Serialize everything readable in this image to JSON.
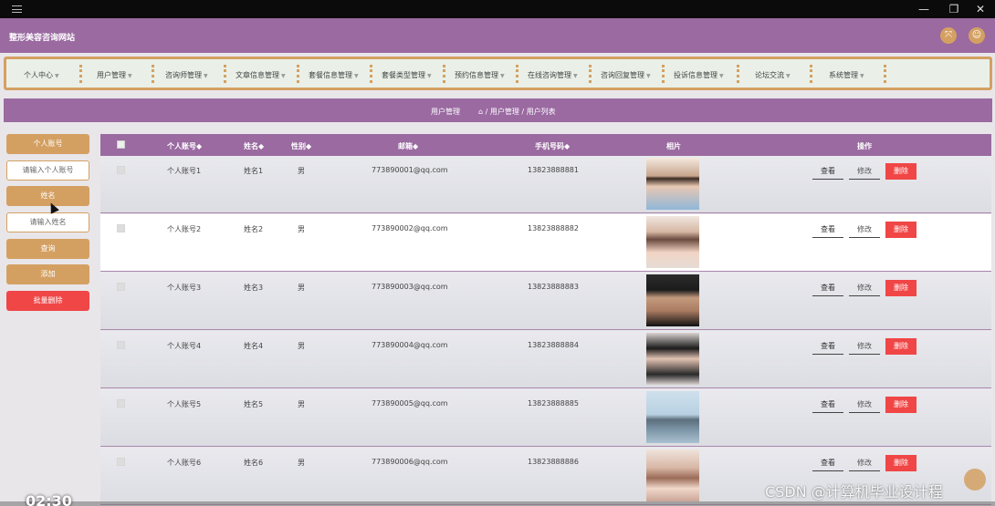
{
  "window": {
    "minimize": "—",
    "restore": "❐",
    "close": "✕"
  },
  "header": {
    "title": "整形美容咨询网站"
  },
  "nav": {
    "items": [
      {
        "label": "个人中心"
      },
      {
        "label": "用户管理"
      },
      {
        "label": "咨询师管理"
      },
      {
        "label": "文章信息管理"
      },
      {
        "label": "套餐信息管理"
      },
      {
        "label": "套餐类型管理"
      },
      {
        "label": "预约信息管理"
      },
      {
        "label": "在线咨询管理"
      },
      {
        "label": "咨询回复管理"
      },
      {
        "label": "投诉信息管理"
      },
      {
        "label": "论坛交流"
      },
      {
        "label": "系统管理"
      }
    ],
    "caret": "▼"
  },
  "breadcrumb": {
    "section": "用户管理",
    "path": "/ 用户管理 / 用户列表",
    "home_icon": "⌂"
  },
  "left": {
    "account_label": "个人账号",
    "account_placeholder": "请输入个人账号",
    "name_label": "姓名",
    "name_placeholder": "请输入姓名",
    "search": "查询",
    "add": "添加",
    "batch_delete": "批量删除"
  },
  "table": {
    "headers": {
      "account": "个人账号◆",
      "name": "姓名◆",
      "gender": "性别◆",
      "email": "邮箱◆",
      "phone": "手机号码◆",
      "photo": "相片",
      "actions": "操作"
    },
    "rows": [
      {
        "account": "个人账号1",
        "name": "姓名1",
        "gender": "男",
        "email": "773890001@qq.com",
        "phone": "13823888881"
      },
      {
        "account": "个人账号2",
        "name": "姓名2",
        "gender": "男",
        "email": "773890002@qq.com",
        "phone": "13823888882"
      },
      {
        "account": "个人账号3",
        "name": "姓名3",
        "gender": "男",
        "email": "773890003@qq.com",
        "phone": "13823888883"
      },
      {
        "account": "个人账号4",
        "name": "姓名4",
        "gender": "男",
        "email": "773890004@qq.com",
        "phone": "13823888884"
      },
      {
        "account": "个人账号5",
        "name": "姓名5",
        "gender": "男",
        "email": "773890005@qq.com",
        "phone": "13823888885"
      },
      {
        "account": "个人账号6",
        "name": "姓名6",
        "gender": "男",
        "email": "773890006@qq.com",
        "phone": "13823888886"
      }
    ],
    "actions": {
      "view": "查看",
      "edit": "修改",
      "delete": "删除"
    }
  },
  "overlay": {
    "watermark": "CSDN @计算机毕业设计程",
    "timecode": "02:30"
  },
  "colors": {
    "accent": "#9a6aa1",
    "brand": "#d4a062",
    "danger": "#f04646"
  }
}
